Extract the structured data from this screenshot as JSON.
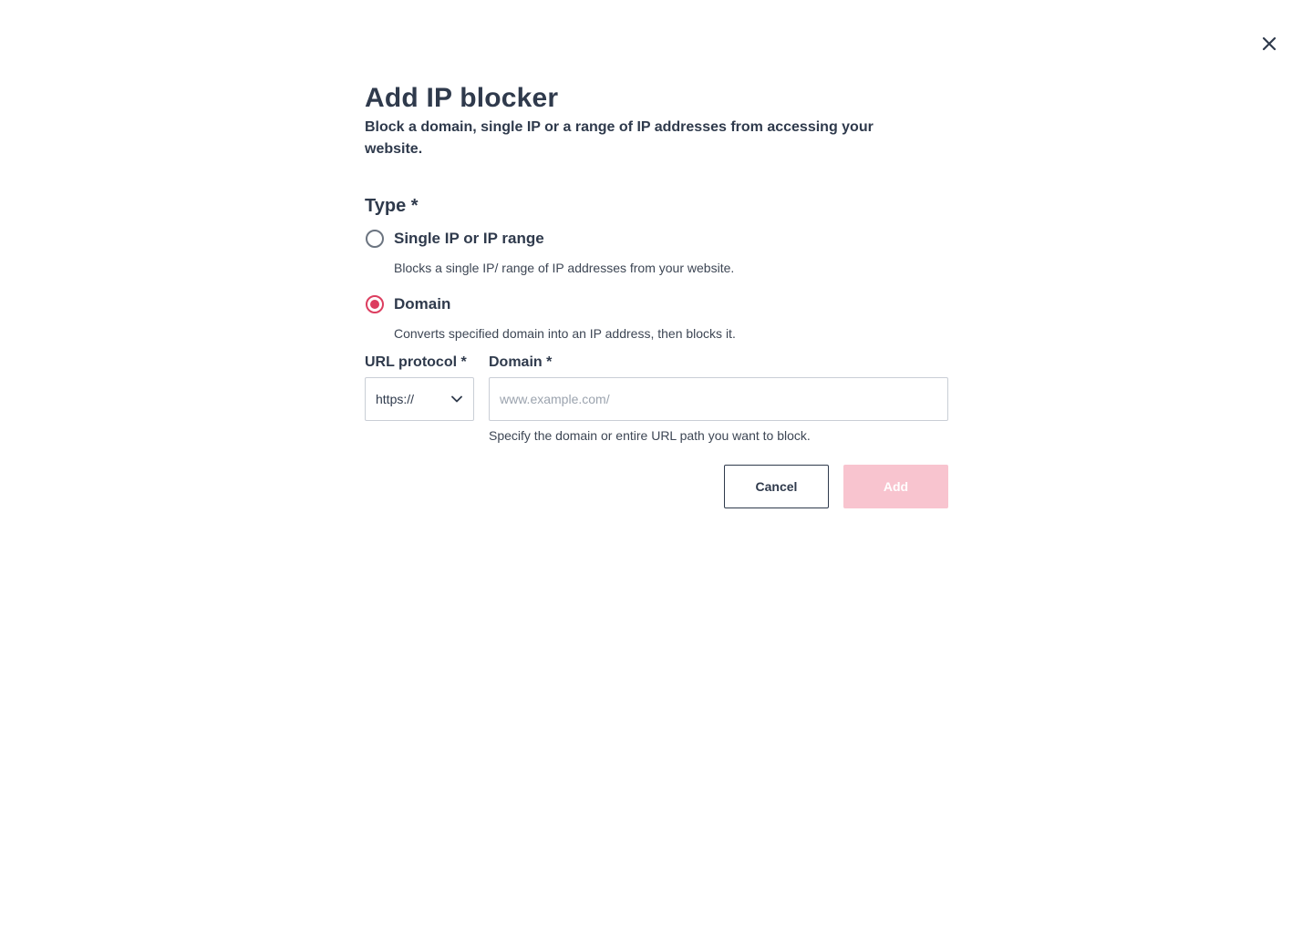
{
  "dialog": {
    "title": "Add IP blocker",
    "subtitle": "Block a domain, single IP or a range of IP addresses from accessing your website.",
    "close_icon": "close-icon"
  },
  "type": {
    "label": "Type *",
    "options": [
      {
        "label": "Single IP or IP range",
        "description": "Blocks a single IP/ range of IP addresses from your website.",
        "selected": false
      },
      {
        "label": "Domain",
        "description": "Converts specified domain into an IP address, then blocks it.",
        "selected": true
      }
    ]
  },
  "url_protocol": {
    "label": "URL protocol *",
    "value": "https://",
    "icon": "chevron-down-icon"
  },
  "domain": {
    "label": "Domain *",
    "value": "",
    "placeholder": "www.example.com/",
    "helper": "Specify the domain or entire URL path you want to block."
  },
  "actions": {
    "cancel_label": "Cancel",
    "add_label": "Add",
    "add_enabled": false
  },
  "colors": {
    "accent": "#dc3d5f",
    "accent_disabled": "#f8c4cf",
    "text": "#2f3a4c",
    "border": "#c9ced6"
  }
}
